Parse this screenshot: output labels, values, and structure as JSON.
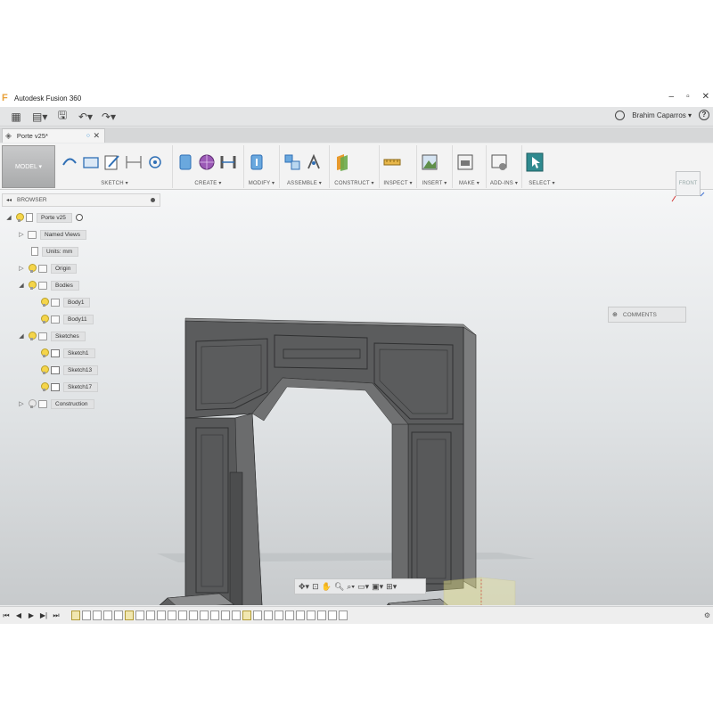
{
  "window": {
    "title": "Autodesk Fusion 360"
  },
  "quick_access": {
    "user_name": "Brahim Caparros ▾"
  },
  "document_tab": {
    "name": "Porte v25*"
  },
  "ribbon": {
    "workspace_label": "MODEL ▾",
    "groups": [
      {
        "label": "SKETCH ▾"
      },
      {
        "label": "CREATE ▾"
      },
      {
        "label": "MODIFY ▾"
      },
      {
        "label": "ASSEMBLE ▾"
      },
      {
        "label": "CONSTRUCT ▾"
      },
      {
        "label": "INSPECT ▾"
      },
      {
        "label": "INSERT ▾"
      },
      {
        "label": "MAKE ▾"
      },
      {
        "label": "ADD-INS ▾"
      },
      {
        "label": "SELECT ▾"
      }
    ]
  },
  "browser": {
    "title": "BROWSER",
    "items": [
      {
        "label": "Porte v25"
      },
      {
        "label": "Named Views"
      },
      {
        "label": "Units: mm"
      },
      {
        "label": "Origin"
      },
      {
        "label": "Bodies"
      },
      {
        "label": "Body1"
      },
      {
        "label": "Body11"
      },
      {
        "label": "Sketches"
      },
      {
        "label": "Sketch1"
      },
      {
        "label": "Sketch13"
      },
      {
        "label": "Sketch17"
      },
      {
        "label": "Construction"
      }
    ]
  },
  "comments": {
    "label": "COMMENTS"
  },
  "viewcube": {
    "face_label": "FRONT"
  },
  "colors": {
    "model_fill": "#5a5b5c",
    "model_edge": "#2d2e2f",
    "accent_blue": "#1e88d6",
    "bulb_yellow": "#f5d54a"
  }
}
